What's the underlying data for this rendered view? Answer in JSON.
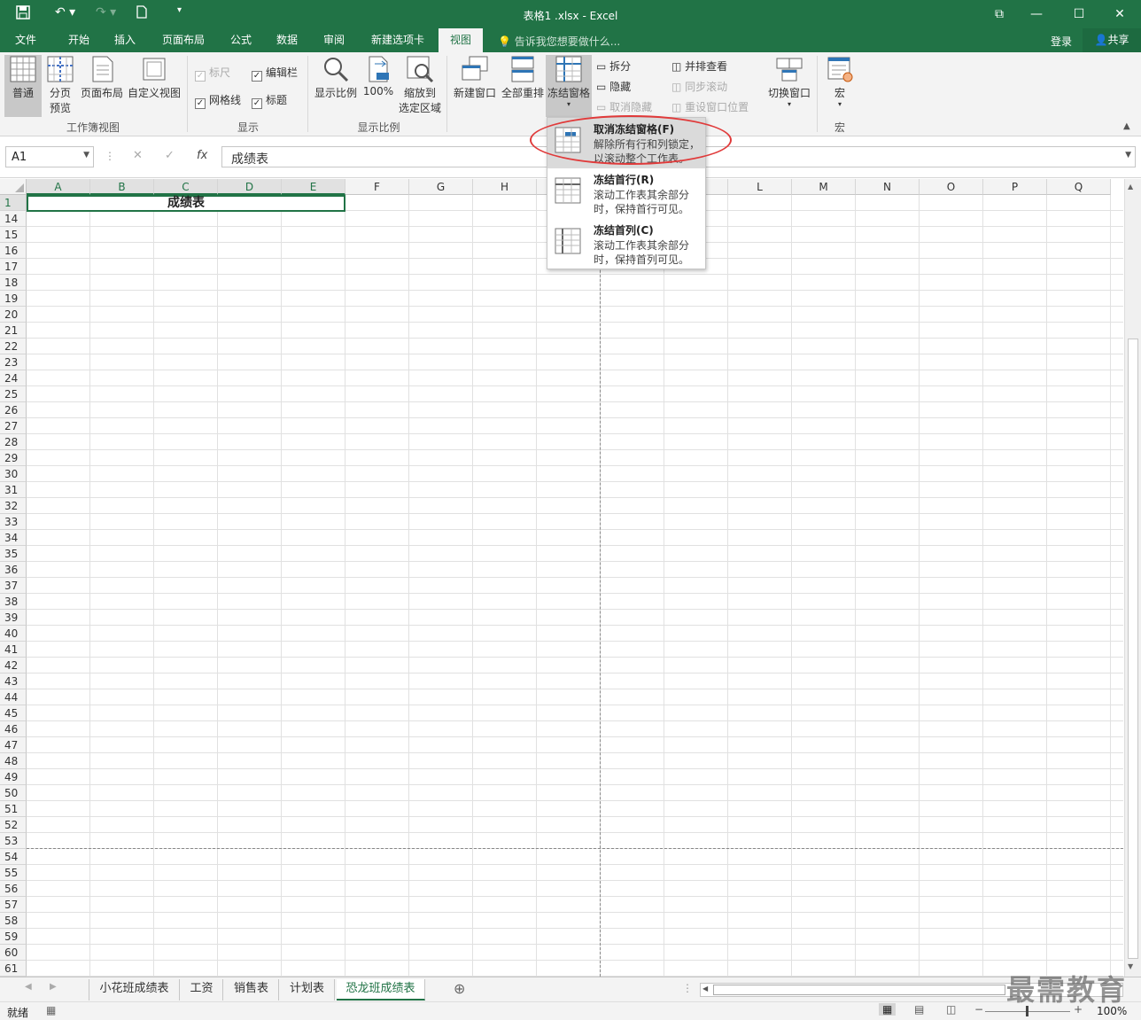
{
  "window": {
    "title": "表格1 .xlsx - Excel"
  },
  "tabs": [
    {
      "label": "文件"
    },
    {
      "label": "开始"
    },
    {
      "label": "插入"
    },
    {
      "label": "页面布局"
    },
    {
      "label": "公式"
    },
    {
      "label": "数据"
    },
    {
      "label": "审阅"
    },
    {
      "label": "新建选项卡"
    },
    {
      "label": "视图"
    }
  ],
  "tellme": "告诉我您想要做什么...",
  "login": "登录",
  "share": "共享",
  "ribbon": {
    "workbook_views": {
      "normal": "普通",
      "page_break_1": "分页",
      "page_break_2": "预览",
      "page_layout": "页面布局",
      "custom_views": "自定义视图",
      "label": "工作簿视图"
    },
    "show": {
      "ruler": "标尺",
      "formula_bar": "编辑栏",
      "gridlines": "网格线",
      "headings": "标题",
      "label": "显示"
    },
    "zoom": {
      "zoom": "显示比例",
      "hundred": "100%",
      "zoom_sel_1": "缩放到",
      "zoom_sel_2": "选定区域",
      "label": "显示比例"
    },
    "window": {
      "new_window": "新建窗口",
      "arrange_all": "全部重排",
      "freeze": "冻结窗格",
      "split": "拆分",
      "hide": "隐藏",
      "unhide": "取消隐藏",
      "side_by_side": "并排查看",
      "sync_scroll": "同步滚动",
      "reset_pos": "重设窗口位置",
      "switch": "切换窗口"
    },
    "macros": {
      "macros": "宏",
      "label": "宏"
    }
  },
  "formula_bar": {
    "name_box": "A1",
    "content": "成绩表",
    "fx": "fx"
  },
  "columns": [
    "A",
    "B",
    "C",
    "D",
    "E",
    "F",
    "G",
    "H",
    "I",
    "J",
    "K",
    "L",
    "M",
    "N",
    "O",
    "P",
    "Q"
  ],
  "rows": [
    "1",
    "14",
    "15",
    "16",
    "17",
    "18",
    "19",
    "20",
    "21",
    "22",
    "23",
    "24",
    "25",
    "26",
    "27",
    "28",
    "29",
    "30",
    "31",
    "32",
    "33",
    "34",
    "35",
    "36",
    "37",
    "38",
    "39",
    "40",
    "41",
    "42",
    "43",
    "44",
    "45",
    "46",
    "47",
    "48",
    "49",
    "50",
    "51",
    "52",
    "53",
    "54",
    "55",
    "56",
    "57",
    "58",
    "59",
    "60",
    "61"
  ],
  "cell_a1": "成绩表",
  "freeze_menu": [
    {
      "title": "取消冻结窗格(F)",
      "desc": "解除所有行和列锁定，以滚动整个工作表。"
    },
    {
      "title": "冻结首行(R)",
      "desc": "滚动工作表其余部分时，保持首行可见。"
    },
    {
      "title": "冻结首列(C)",
      "desc": "滚动工作表其余部分时，保持首列可见。"
    }
  ],
  "sheets": [
    "小花班成绩表",
    "工资",
    "销售表",
    "计划表",
    "恐龙班成绩表"
  ],
  "status": {
    "ready": "就绪",
    "zoom": "100%"
  },
  "watermark": "最需教育",
  "colors": {
    "accent": "#217346",
    "highlight_circle": "#e03a3a"
  }
}
